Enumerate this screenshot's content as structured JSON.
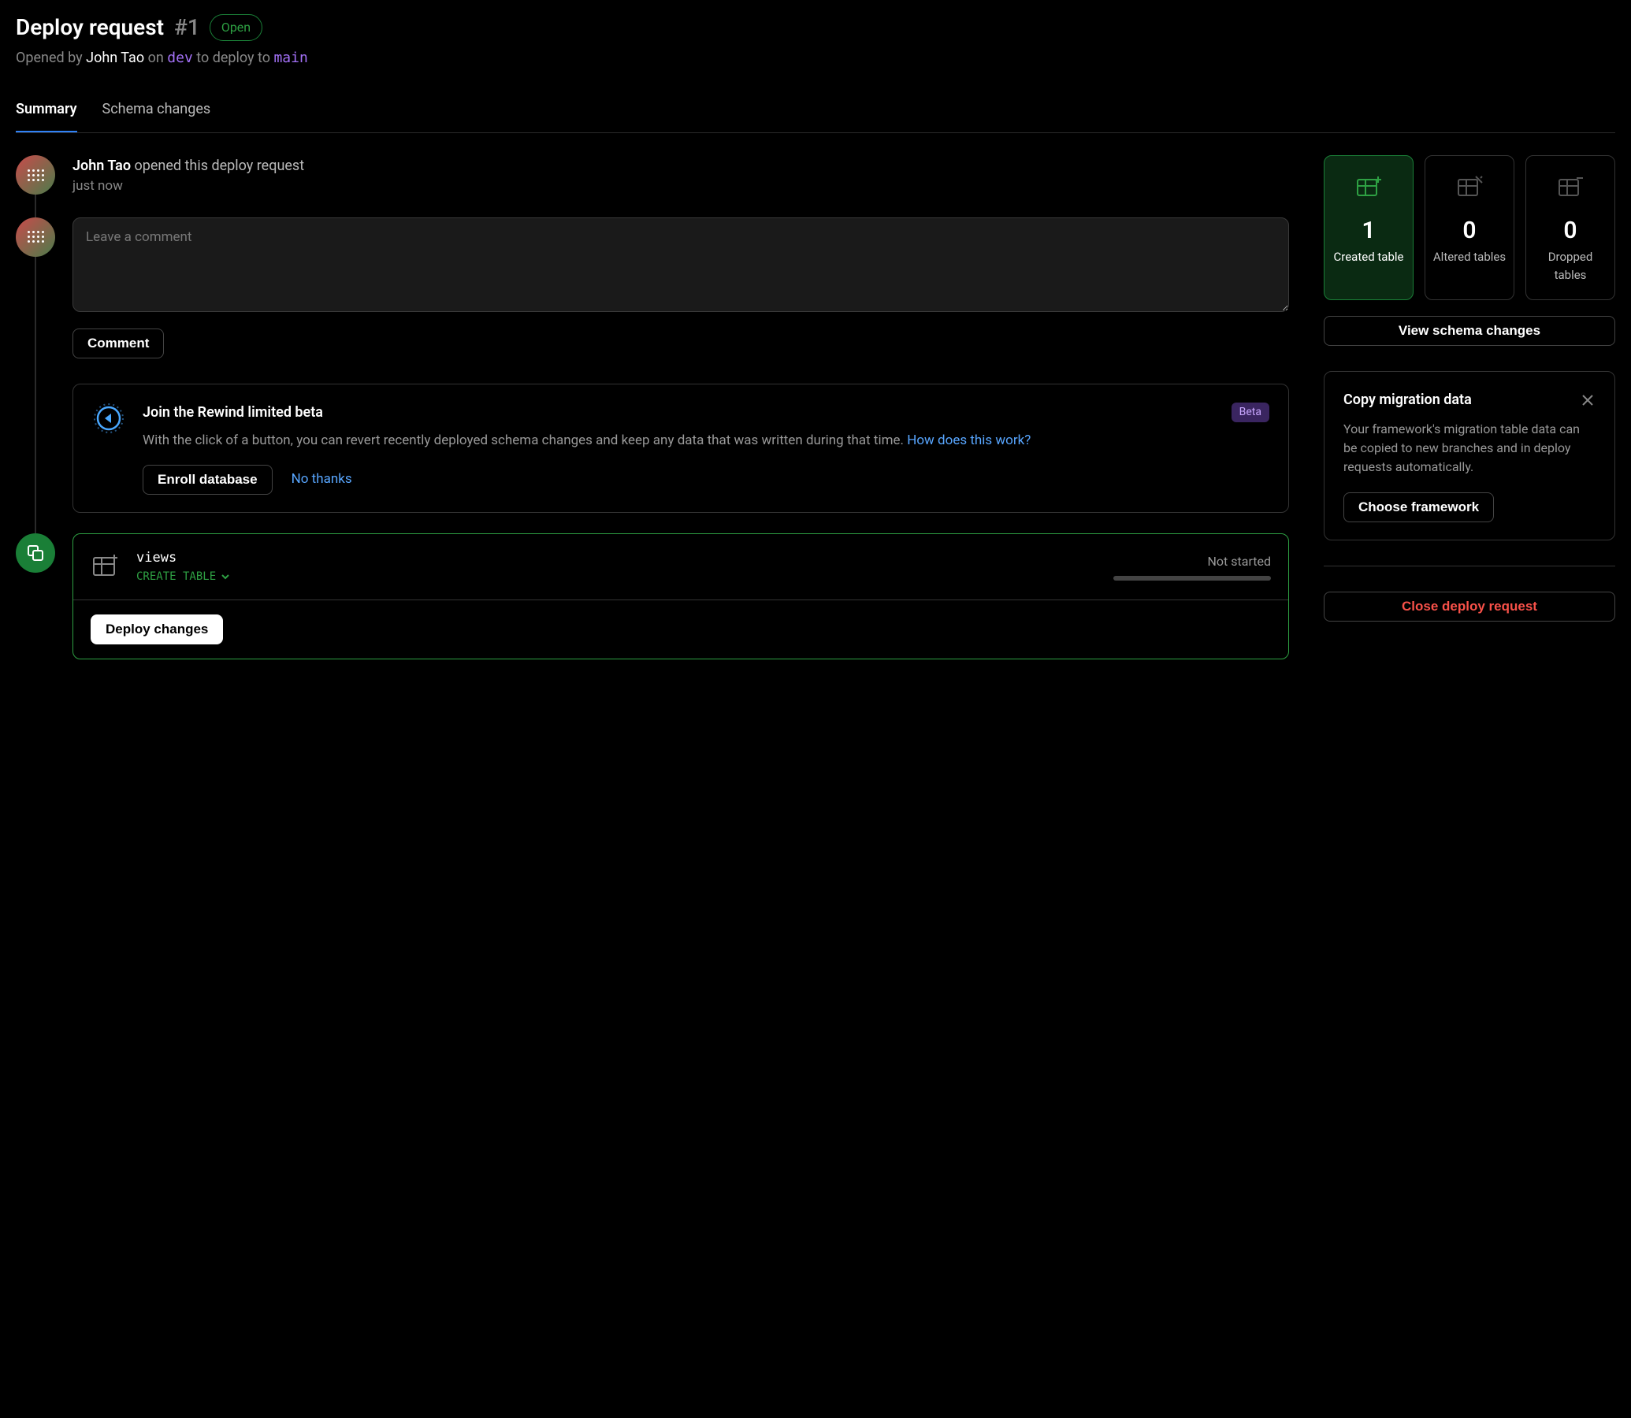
{
  "header": {
    "title": "Deploy request",
    "number": "#1",
    "status": "Open",
    "opened_by_prefix": "Opened by",
    "user": "John Tao",
    "on_text": "on",
    "from_branch": "dev",
    "to_text": "to deploy to",
    "to_branch": "main"
  },
  "tabs": {
    "summary": "Summary",
    "schema": "Schema changes"
  },
  "event": {
    "user": "John Tao",
    "action": "opened this deploy request",
    "time": "just now"
  },
  "comment": {
    "placeholder": "Leave a comment",
    "button": "Comment"
  },
  "rewind": {
    "title": "Join the Rewind limited beta",
    "badge": "Beta",
    "desc": "With the click of a button, you can revert recently deployed schema changes and keep any data that was written during that time. ",
    "link": "How does this work?",
    "enroll": "Enroll database",
    "dismiss": "No thanks"
  },
  "change": {
    "name": "views",
    "action": "CREATE TABLE",
    "status": "Not started",
    "deploy": "Deploy changes"
  },
  "stats": {
    "created": {
      "num": "1",
      "label": "Created table"
    },
    "altered": {
      "num": "0",
      "label": "Altered tables"
    },
    "dropped": {
      "num": "0",
      "label": "Dropped tables"
    }
  },
  "view_schema": "View schema changes",
  "migration": {
    "title": "Copy migration data",
    "desc": "Your framework's migration table data can be copied to new branches and in deploy requests automatically.",
    "button": "Choose framework"
  },
  "close_request": "Close deploy request"
}
